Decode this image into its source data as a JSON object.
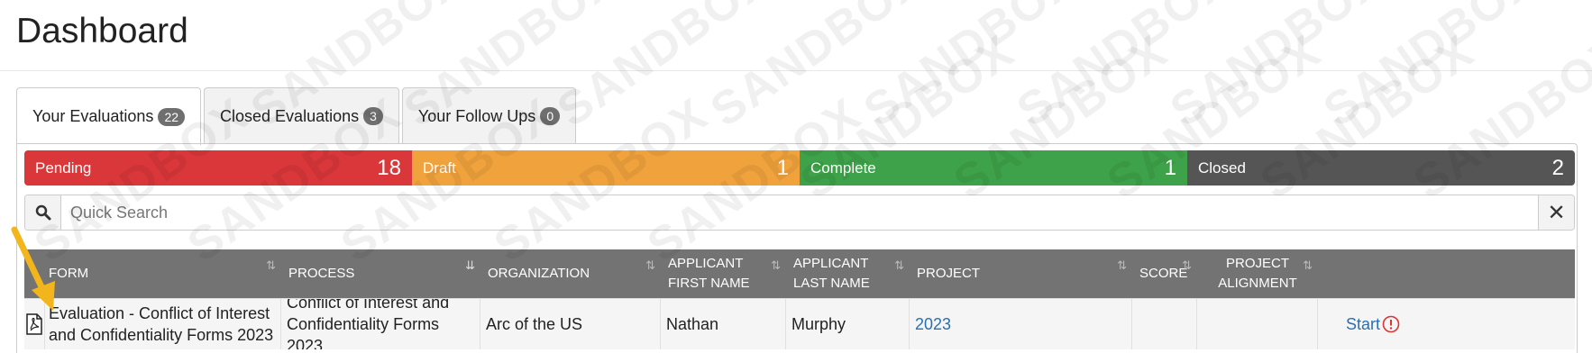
{
  "header": {
    "title": "Dashboard"
  },
  "watermark": "SANDBOX",
  "tabs": [
    {
      "label": "Your Evaluations",
      "count": "22"
    },
    {
      "label": "Closed Evaluations",
      "count": "3"
    },
    {
      "label": "Your Follow Ups",
      "count": "0"
    }
  ],
  "status": [
    {
      "label": "Pending",
      "count": "18",
      "color": "#d9373a"
    },
    {
      "label": "Draft",
      "count": "1",
      "color": "#f0a23c"
    },
    {
      "label": "Complete",
      "count": "1",
      "color": "#3ea24a"
    },
    {
      "label": "Closed",
      "count": "2",
      "color": "#555555"
    }
  ],
  "search": {
    "placeholder": "Quick Search",
    "clear": "✕"
  },
  "table": {
    "columns": [
      "Form",
      "Process",
      "Organization",
      "Applicant First Name",
      "Applicant Last Name",
      "Project",
      "Score",
      "Project Alignment",
      ""
    ],
    "rows": [
      {
        "form": "Evaluation - Conflict of Interest and Confidentiality Forms 2023",
        "process": "Conflict of Interest and Confidentiality Forms 2023",
        "organization": "Arc of the US",
        "first_name": "Nathan",
        "last_name": "Murphy",
        "project": "2023",
        "score": "",
        "alignment": "",
        "action": "Start"
      }
    ]
  },
  "icons": {
    "search": "search-icon",
    "pdf": "pdf-icon",
    "alert": "alert-icon",
    "arrow": "pointer-arrow-icon"
  }
}
